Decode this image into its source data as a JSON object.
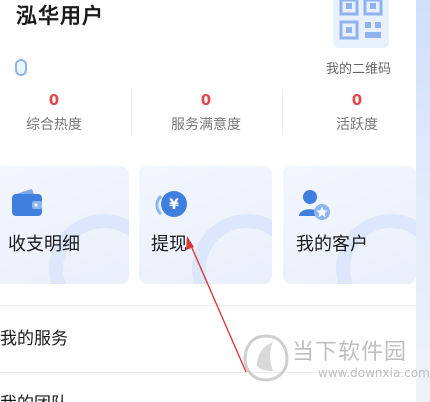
{
  "profile": {
    "username": "泓华用户"
  },
  "qr": {
    "label": "我的二维码"
  },
  "stats": [
    {
      "value": "0",
      "label": "综合热度"
    },
    {
      "value": "0",
      "label": "服务满意度"
    },
    {
      "value": "0",
      "label": "活跃度"
    }
  ],
  "cards": [
    {
      "label": "收支明细",
      "icon": "wallet-icon"
    },
    {
      "label": "提现",
      "icon": "withdraw-yen-icon"
    },
    {
      "label": "我的客户",
      "icon": "customer-star-icon"
    }
  ],
  "menu": [
    {
      "label": "我的服务"
    },
    {
      "label": "我的团队"
    }
  ],
  "watermark": {
    "text": "当下软件园",
    "url": "www.downxia.com"
  },
  "colors": {
    "accent": "#3f7fe0",
    "stat_number": "#e0484c",
    "annotation_arrow": "#d93a3a"
  }
}
